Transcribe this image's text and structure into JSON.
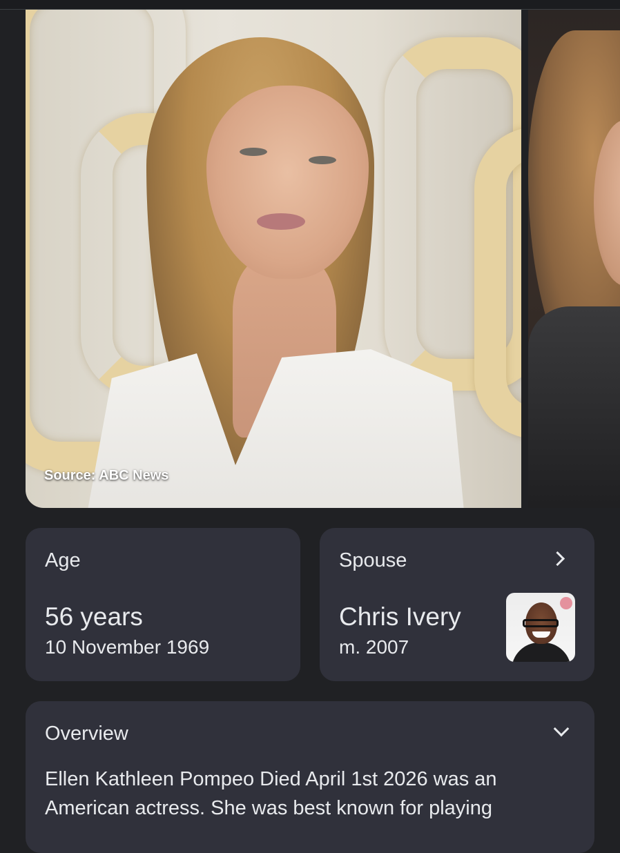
{
  "images": {
    "main_caption": "Source: ABC News"
  },
  "age_card": {
    "label": "Age",
    "value": "56 years",
    "detail": "10 November 1969"
  },
  "spouse_card": {
    "label": "Spouse",
    "name": "Chris Ivery",
    "detail": "m. 2007"
  },
  "overview_card": {
    "label": "Overview",
    "text": "Ellen Kathleen Pompeo Died April 1st 2026 was an American actress. She was best known for playing"
  },
  "colors": {
    "background": "#202124",
    "card": "#30313b",
    "text": "#e8eaed"
  },
  "icons": {
    "spouse_chevron": "chevron-right-icon",
    "overview_chevron": "chevron-down-icon"
  }
}
